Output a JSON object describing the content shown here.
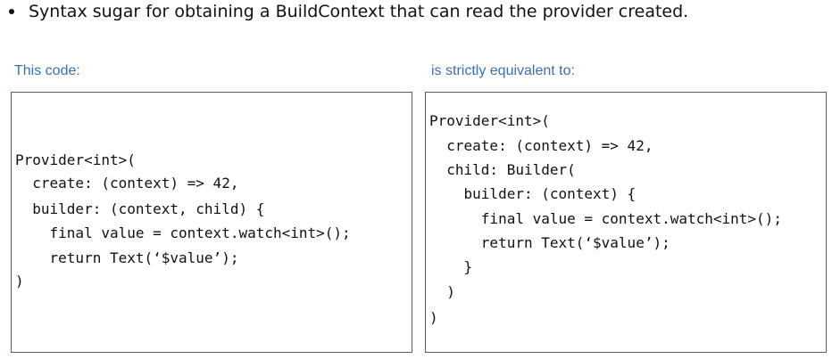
{
  "bullet": {
    "text": "Syntax sugar for obtaining a BuildContext that can read the provider created."
  },
  "left": {
    "label": "This code:",
    "lines": [
      "Provider<int>(",
      "  create: (context) => 42,",
      "  builder: (context, child) {",
      "    final value = context.watch<int>();",
      "    return Text(‘$value’);",
      ")"
    ]
  },
  "right": {
    "label": "is strictly equivalent to:",
    "lines": [
      "Provider<int>(",
      "  create: (context) => 42,",
      "  child: Builder(",
      "    builder: (context) {",
      "      final value = context.watch<int>();",
      "      return Text(‘$value’);",
      "    }",
      "  )",
      ")"
    ]
  }
}
